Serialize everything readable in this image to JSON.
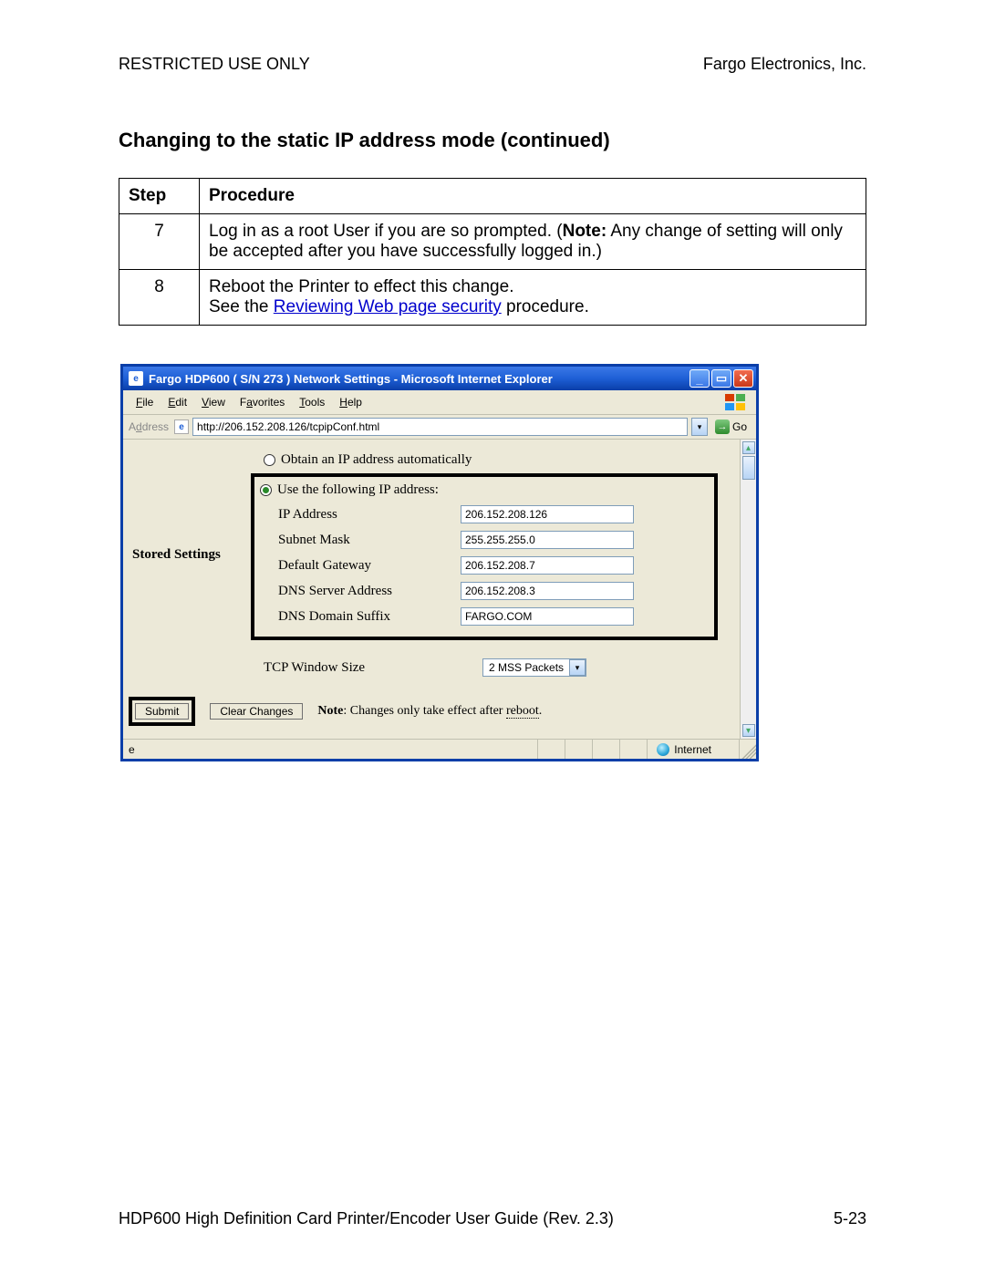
{
  "header": {
    "restricted": "RESTRICTED USE ONLY",
    "company": "Fargo Electronics, Inc."
  },
  "section_title": "Changing to the static IP address mode (continued)",
  "table": {
    "col_step": "Step",
    "col_proc": "Procedure",
    "rows": [
      {
        "num": "7",
        "text_a": "Log in as a root User if you are so prompted. (",
        "note_label": "Note:",
        "text_b": "  Any change of setting will only be accepted after you have successfully logged in.)"
      },
      {
        "num": "8",
        "line1": "Reboot the Printer to effect this change.",
        "line2a": "See the ",
        "link": "Reviewing Web page security",
        "line2b": " procedure."
      }
    ]
  },
  "browser": {
    "title": "Fargo HDP600 ( S/N 273 ) Network Settings - Microsoft Internet Explorer",
    "menu": {
      "file": "File",
      "edit": "Edit",
      "view": "View",
      "favorites": "Favorites",
      "tools": "Tools",
      "help": "Help"
    },
    "addr_label": "Address",
    "url": "http://206.152.208.126/tcpipConf.html",
    "go": "Go",
    "side_label": "Stored Settings",
    "radio_auto": "Obtain an IP address automatically",
    "radio_static": "Use the following IP address:",
    "fields": {
      "ip_label": "IP Address",
      "ip_value": "206.152.208.126",
      "mask_label": "Subnet Mask",
      "mask_value": "255.255.255.0",
      "gw_label": "Default Gateway",
      "gw_value": "206.152.208.7",
      "dns_label": "DNS Server Address",
      "dns_value": "206.152.208.3",
      "suffix_label": "DNS Domain Suffix",
      "suffix_value": "FARGO.COM"
    },
    "tcp_label": "TCP Window Size",
    "tcp_value": "2 MSS Packets",
    "submit": "Submit",
    "clear": "Clear Changes",
    "note_prefix": "Note",
    "note_text": ": Changes only take effect after ",
    "note_reboot": "reboot",
    "note_suffix": ".",
    "status_zone": "Internet"
  },
  "footer": {
    "guide": "HDP600 High Definition Card Printer/Encoder User Guide (Rev. 2.3)",
    "page": "5-23"
  }
}
